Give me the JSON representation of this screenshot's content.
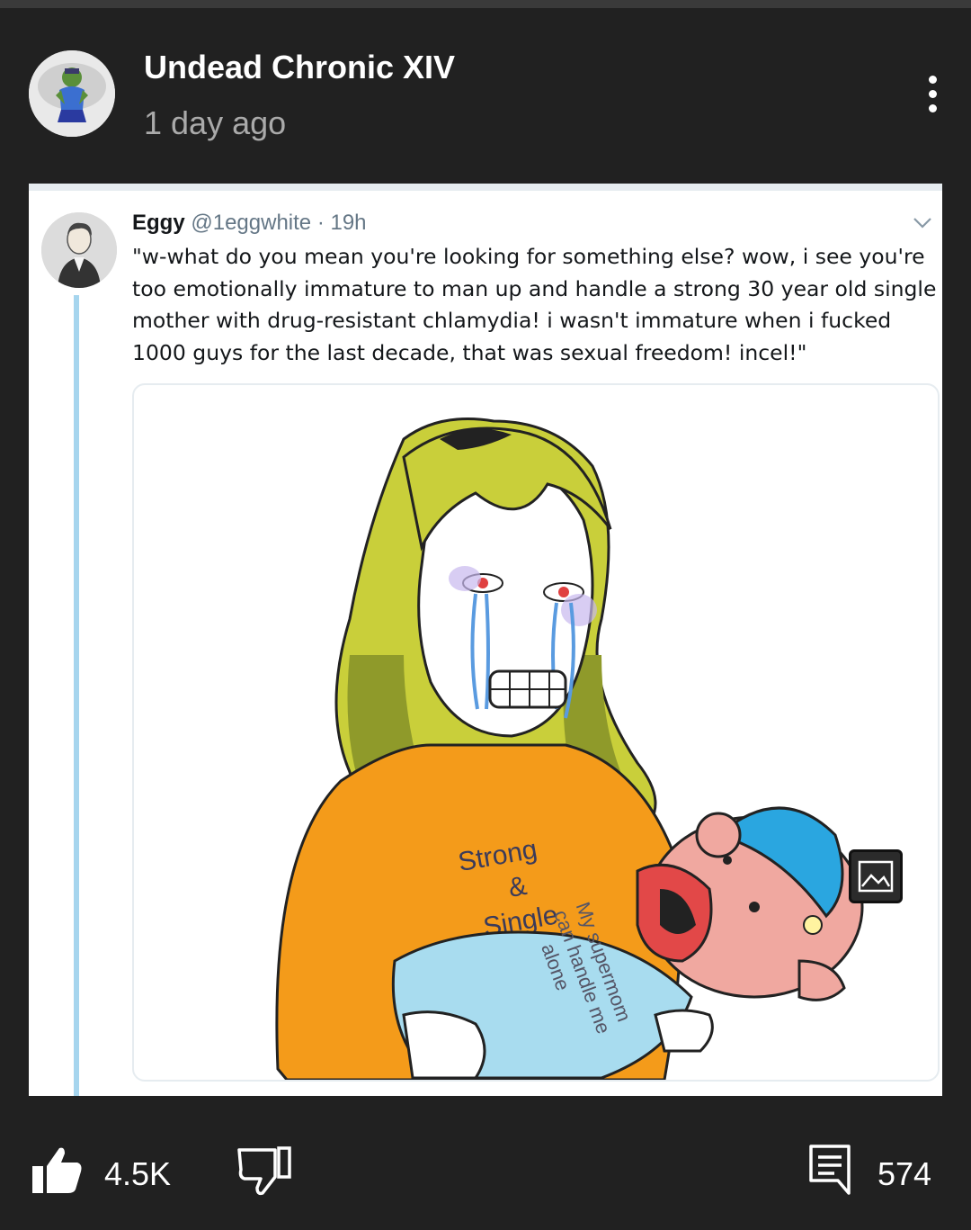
{
  "post": {
    "author": "Undead Chronic XIV",
    "time_ago": "1 day ago"
  },
  "tweet": {
    "name": "Eggy",
    "handle": "@1eggwhite",
    "separator": "·",
    "age": "19h",
    "text": "\"w-what do you mean you're looking for something else? wow, i see you're too emotionally immature to man up and handle a strong 30 year old single mother with drug-resistant chlamydia! i wasn't immature when i fucked 1000 guys for the last decade, that was sexual freedom! incel!\"",
    "meme_sweater_text": [
      "Strong",
      "&",
      "Single"
    ],
    "meme_blanket_text": [
      "My supermom",
      "can handle me",
      "alone"
    ]
  },
  "actions": {
    "likes": "4.5K",
    "comments": "574"
  },
  "icons": [
    "avatar",
    "more-vert-icon",
    "chevron-down-icon",
    "gallery-icon",
    "thumbs-up-icon",
    "thumbs-down-icon",
    "comment-icon"
  ],
  "colors": {
    "background": "#212121",
    "thread_line": "#a6d5ee",
    "sweater": "#f49b1a",
    "hair": "#c9cf3a"
  }
}
